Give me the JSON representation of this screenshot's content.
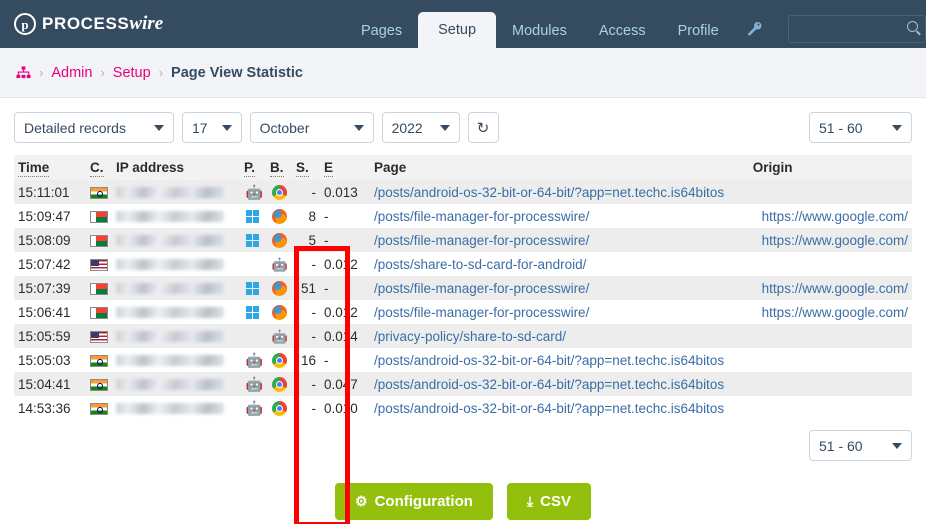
{
  "masthead": {
    "logo_mark": "p",
    "logo_text_1": "PROCESS",
    "logo_text_2": "wire",
    "nav": [
      {
        "label": "Pages",
        "active": false
      },
      {
        "label": "Setup",
        "active": true
      },
      {
        "label": "Modules",
        "active": false
      },
      {
        "label": "Access",
        "active": false
      },
      {
        "label": "Profile",
        "active": false
      }
    ],
    "tool_icon": "wrench-icon",
    "search": {
      "value": "",
      "placeholder": "",
      "icon": "search-icon"
    }
  },
  "breadcrumb": {
    "home_icon": "sitemap-icon",
    "separator": "›",
    "items": [
      {
        "label": "Admin",
        "current": false
      },
      {
        "label": "Setup",
        "current": false
      },
      {
        "label": "Page View Statistic",
        "current": true
      }
    ]
  },
  "toolbar": {
    "view_mode": "Detailed records",
    "day": "17",
    "month": "October",
    "year": "2022",
    "refresh_icon": "refresh-icon",
    "refresh_glyph": "↻",
    "pager_top": "51 - 60",
    "pager_bottom": "51 - 60"
  },
  "table": {
    "headers": [
      {
        "key": "time",
        "label": "Time",
        "abbr": true
      },
      {
        "key": "country",
        "label": "C.",
        "abbr": true
      },
      {
        "key": "ip",
        "label": "IP address",
        "abbr": false
      },
      {
        "key": "platform",
        "label": "P.",
        "abbr": true
      },
      {
        "key": "browser",
        "label": "B.",
        "abbr": true
      },
      {
        "key": "session",
        "label": "S.",
        "abbr": true
      },
      {
        "key": "engine",
        "label": "E",
        "abbr": true
      },
      {
        "key": "page",
        "label": "Page",
        "abbr": false
      },
      {
        "key": "origin",
        "label": "Origin",
        "abbr": false
      }
    ],
    "rows": [
      {
        "time": "15:11:01",
        "flag": "in",
        "ip": "",
        "platform": "android",
        "browser": "chrome",
        "session": "-",
        "engine": "0.013",
        "page": "/posts/android-os-32-bit-or-64-bit/?app=net.techc.is64bitos",
        "origin": ""
      },
      {
        "time": "15:09:47",
        "flag": "mg",
        "ip": "",
        "platform": "windows",
        "browser": "firefox",
        "session": "8",
        "engine": "-",
        "page": "/posts/file-manager-for-processwire/",
        "origin": "https://www.google.com/"
      },
      {
        "time": "15:08:09",
        "flag": "mg",
        "ip": "",
        "platform": "windows",
        "browser": "firefox",
        "session": "5",
        "engine": "-",
        "page": "/posts/file-manager-for-processwire/",
        "origin": "https://www.google.com/"
      },
      {
        "time": "15:07:42",
        "flag": "us",
        "ip": "",
        "platform": "",
        "browser": "bot",
        "session": "-",
        "engine": "0.012",
        "page": "/posts/share-to-sd-card-for-android/",
        "origin": ""
      },
      {
        "time": "15:07:39",
        "flag": "mg",
        "ip": "",
        "platform": "windows",
        "browser": "firefox",
        "session": "51",
        "engine": "-",
        "page": "/posts/file-manager-for-processwire/",
        "origin": "https://www.google.com/"
      },
      {
        "time": "15:06:41",
        "flag": "mg",
        "ip": "",
        "platform": "windows",
        "browser": "firefox",
        "session": "-",
        "engine": "0.012",
        "page": "/posts/file-manager-for-processwire/",
        "origin": "https://www.google.com/"
      },
      {
        "time": "15:05:59",
        "flag": "us",
        "ip": "",
        "platform": "",
        "browser": "bot",
        "session": "-",
        "engine": "0.014",
        "page": "/privacy-policy/share-to-sd-card/",
        "origin": ""
      },
      {
        "time": "15:05:03",
        "flag": "in",
        "ip": "",
        "platform": "android",
        "browser": "chrome",
        "session": "16",
        "engine": "-",
        "page": "/posts/android-os-32-bit-or-64-bit/?app=net.techc.is64bitos",
        "origin": ""
      },
      {
        "time": "15:04:41",
        "flag": "in",
        "ip": "",
        "platform": "android",
        "browser": "chrome",
        "session": "-",
        "engine": "0.047",
        "page": "/posts/android-os-32-bit-or-64-bit/?app=net.techc.is64bitos",
        "origin": ""
      },
      {
        "time": "14:53:36",
        "flag": "in",
        "ip": "",
        "platform": "android",
        "browser": "chrome",
        "session": "-",
        "engine": "0.010",
        "page": "/posts/android-os-32-bit-or-64-bit/?app=net.techc.is64bitos",
        "origin": ""
      }
    ]
  },
  "buttons": {
    "configuration": {
      "label": "Configuration",
      "icon": "gear-icon",
      "glyph": "⚙"
    },
    "csv": {
      "label": "CSV",
      "icon": "download-icon",
      "glyph": "⤓"
    }
  },
  "annotation": {
    "shape": "rectangle",
    "color": "#fe0000",
    "highlights_column": "E"
  },
  "colors": {
    "masthead_bg": "#354b60",
    "accent_pink": "#e6007e",
    "link_blue": "#3a6ea5",
    "button_green": "#93bf0d",
    "annotation_red": "#fe0000"
  }
}
